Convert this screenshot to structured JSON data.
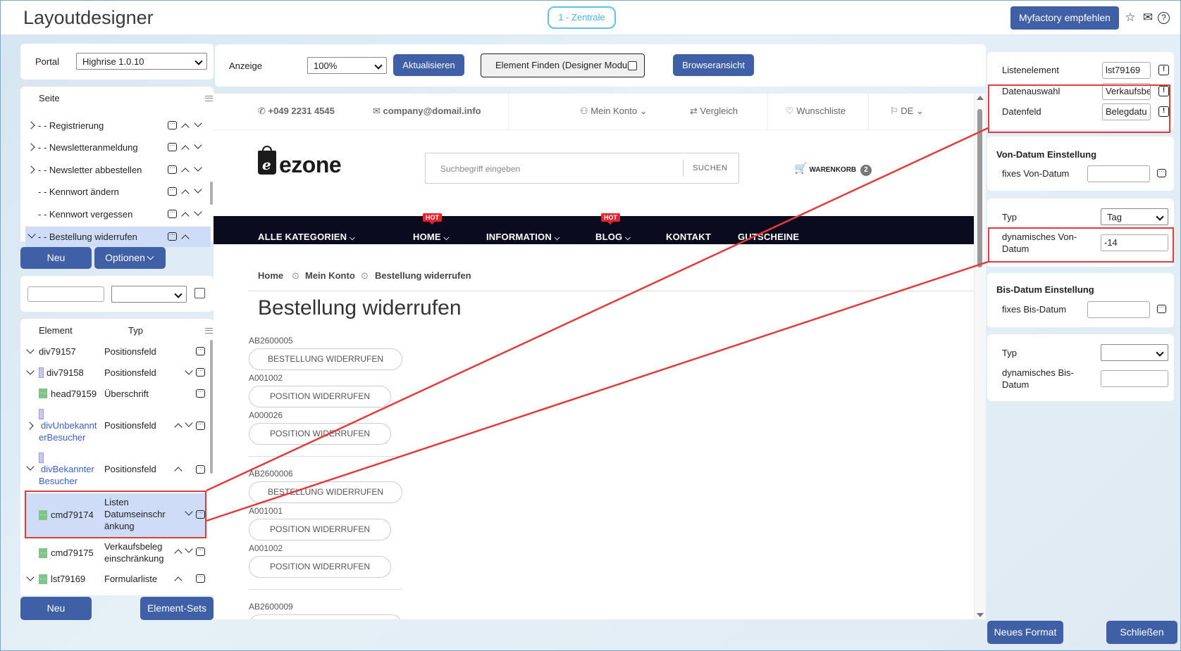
{
  "app": {
    "title": "Layoutdesigner",
    "branch": "1 - Zentrale",
    "recommend": "Myfactory empfehlen"
  },
  "portal": {
    "label": "Portal",
    "value": "Highrise 1.0.10"
  },
  "pagetree": {
    "header": "Seite",
    "items": [
      {
        "label": "- - Registrierung"
      },
      {
        "label": "- - Newsletteranmeldung"
      },
      {
        "label": "- - Newsletter abbestellen"
      },
      {
        "label": "- - Kennwort ändern"
      },
      {
        "label": "- - Kennwort vergessen"
      },
      {
        "label": "- - Bestellung widerrufen"
      }
    ],
    "new": "Neu",
    "options": "Optionen"
  },
  "elements": {
    "col_element": "Element",
    "col_type": "Typ",
    "rows": [
      {
        "name": "div79157",
        "type": "Positionsfeld"
      },
      {
        "name": "div79158",
        "type": "Positionsfeld"
      },
      {
        "name": "head79159",
        "type": "Überschrift"
      },
      {
        "name1": "divUnbekannt",
        "name2": "erBesucher",
        "type": "Positionsfeld"
      },
      {
        "name1": "divBekannter",
        "name2": "Besucher",
        "type": "Positionsfeld"
      },
      {
        "name": "cmd79174",
        "type1": "Listen",
        "type2": "Datumseinschr",
        "type3": "änkung"
      },
      {
        "name": "cmd79175",
        "type1": "Verkaufsbeleg",
        "type2": "einschränkung"
      },
      {
        "name": "lst79169",
        "type": "Formularliste"
      }
    ],
    "new": "Neu",
    "sets": "Element-Sets"
  },
  "toolbar": {
    "anzeige": "Anzeige",
    "zoom": "100%",
    "refresh": "Aktualisieren",
    "find": "Element Finden (Designer Modus)",
    "browser": "Browseransicht"
  },
  "site": {
    "phone": "+049 2231 4545",
    "email": "company@domail.info",
    "account": "Mein Konto",
    "compare": "Vergleich",
    "wishlist": "Wunschliste",
    "lang": "DE",
    "logo": "ezone",
    "search_ph": "Suchbegriff eingeben",
    "search_btn": "SUCHEN",
    "cart": "WARENKORB",
    "cart_count": "2",
    "nav": [
      "ALLE KATEGORIEN",
      "HOME",
      "INFORMATION",
      "BLOG",
      "KONTAKT",
      "GUTSCHEINE"
    ],
    "hot": "HOT",
    "crumbs": [
      "Home",
      "Mein Konto",
      "Bestellung widerrufen"
    ],
    "heading": "Bestellung widerrufen",
    "orders": [
      {
        "code": "AB2600005",
        "btn": "BESTELLUNG WIDERRUFEN",
        "positions": [
          {
            "code": "A001002",
            "btn": "POSITION WIDERRUFEN"
          },
          {
            "code": "A000026",
            "btn": "POSITION WIDERRUFEN"
          }
        ]
      },
      {
        "code": "AB2600006",
        "btn": "BESTELLUNG WIDERRUFEN",
        "positions": [
          {
            "code": "A001001",
            "btn": "POSITION WIDERRUFEN"
          },
          {
            "code": "A001002",
            "btn": "POSITION WIDERRUFEN"
          }
        ]
      },
      {
        "code": "AB2600009"
      }
    ]
  },
  "props": {
    "listelement_label": "Listenelement",
    "listelement_value": "lst79169",
    "datenauswahl_label": "Datenauswahl",
    "datenauswahl_value": "Verkaufsbe",
    "datenfeld_label": "Datenfeld",
    "datenfeld_value": "Belegdatu",
    "von_head": "Von-Datum Einstellung",
    "von_fix": "fixes Von-Datum",
    "typ": "Typ",
    "typ_value": "Tag",
    "dyn_von1": "dynamisches Von-",
    "dyn_von2": "Datum",
    "dyn_von_value": "-14",
    "bis_head": "Bis-Datum Einstellung",
    "bis_fix": "fixes Bis-Datum",
    "typ2": "Typ",
    "dyn_bis1": "dynamisches Bis-",
    "dyn_bis2": "Datum",
    "new_format": "Neues Format",
    "close": "Schließen"
  },
  "colors": {
    "primary": "#3f5fa6",
    "accent": "#5bc4e8",
    "highlight": "#e23b3b",
    "nav": "#0b0b1f"
  }
}
